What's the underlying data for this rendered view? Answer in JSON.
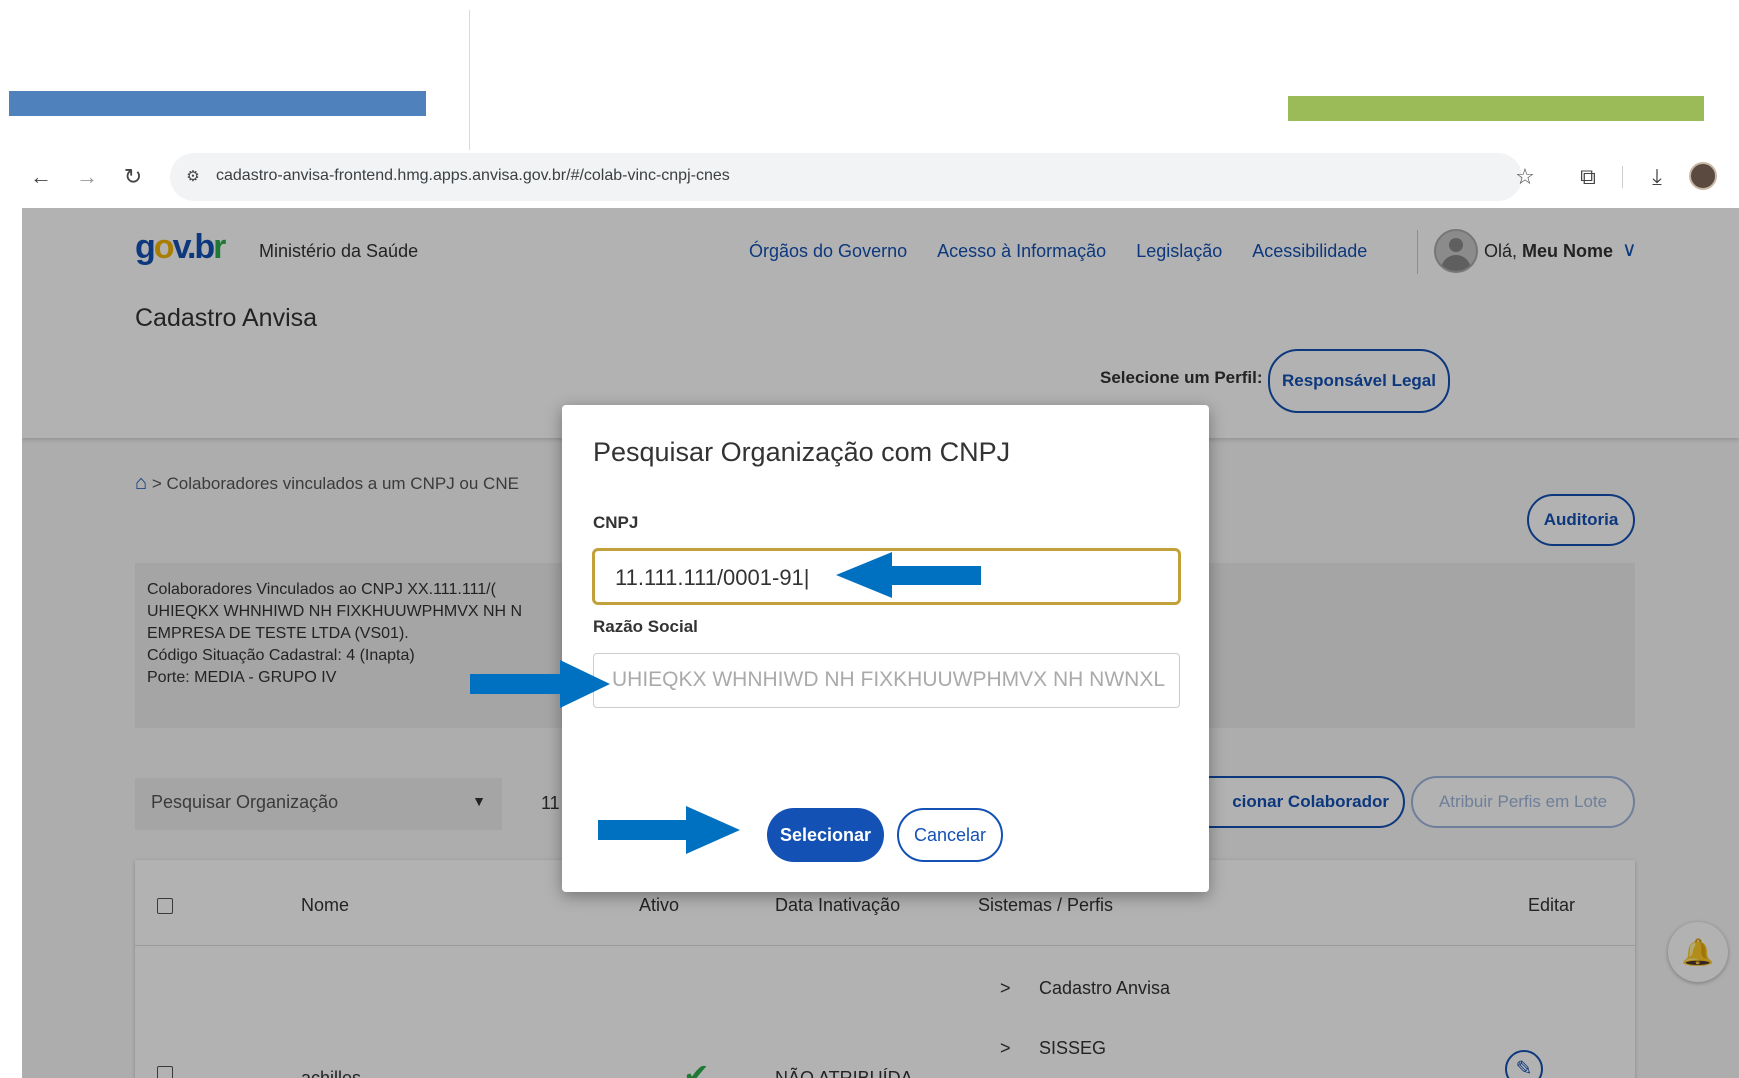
{
  "browser": {
    "url": "cadastro-anvisa-frontend.hmg.apps.anvisa.gov.br/#/colab-vinc-cnpj-cnes"
  },
  "header": {
    "logo_parts": [
      "g",
      "o",
      "v.b",
      "r"
    ],
    "org_name": "Ministério da Saúde",
    "site_title": "Cadastro Anvisa",
    "links": [
      "Órgãos do Governo",
      "Acesso à Informação",
      "Legislação",
      "Acessibilidade"
    ],
    "greeting": "Olá,",
    "user_name": "Meu Nome",
    "profile_label": "Selecione um Perfil:",
    "profile_button": "Responsável Legal"
  },
  "breadcrumb": {
    "separator": ">",
    "text": "Colaboradores vinculados a um CNPJ ou CNE"
  },
  "auditoria_button": "Auditoria",
  "info_box": {
    "lines": [
      "Colaboradores Vinculados ao CNPJ XX.111.111/(",
      "UHIEQKX WHNHIWD NH FIXKHUUWPHMVX NH N",
      "EMPRESA DE TESTE LTDA (VS01).",
      "Código Situação Cadastral: 4 (Inapta)",
      "Porte: MEDIA - GRUPO IV"
    ]
  },
  "filters": {
    "org_select": "Pesquisar Organização",
    "org_value": "11",
    "add_button": "cionar Colaborador",
    "lote_button": "Atribuir Perfis em Lote"
  },
  "table": {
    "headers": {
      "nome": "Nome",
      "ativo": "Ativo",
      "data": "Data Inativação",
      "sistemas": "Sistemas / Perfis",
      "editar": "Editar"
    },
    "row": {
      "nome": "achilles",
      "data": "NÃO ATRIBUÍDA",
      "systems": [
        "Cadastro Anvisa",
        "SISSEG"
      ]
    }
  },
  "modal": {
    "title": "Pesquisar Organização com CNPJ",
    "cnpj_label": "CNPJ",
    "cnpj_value": "11.111.111/0001-91",
    "razao_label": "Razão Social",
    "razao_placeholder": "UHIEQKX WHNHIWD NH FIXKHUUWPHMVX NH NWNXL",
    "select_button": "Selecionar",
    "cancel_button": "Cancelar"
  },
  "colors": {
    "primary": "#1351b4",
    "annotation_arrow": "#0070c0",
    "slide_blue": "#4f81bd",
    "slide_green": "#9bbb59",
    "focus_border": "#c2a13b"
  }
}
